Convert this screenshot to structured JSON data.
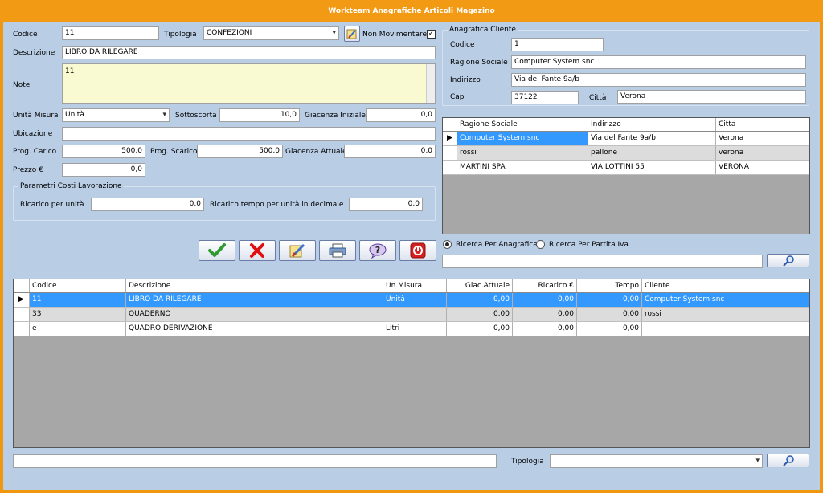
{
  "window": {
    "title": "Workteam Anagrafiche Articoli Magazino"
  },
  "article": {
    "codice_label": "Codice",
    "codice": "11",
    "tipologia_label": "Tipologia",
    "tipologia": "CONFEZIONI",
    "non_movimentare_label": "Non Movimentare",
    "non_movimentare_check": "✓",
    "descrizione_label": "Descrizione",
    "descrizione": "LIBRO DA RILEGARE",
    "note_label": "Note",
    "note": "11",
    "unita_misura_label": "Unità Misura",
    "unita_misura": "Unità",
    "sottoscorta_label": "Sottoscorta",
    "sottoscorta": "10,0",
    "giacenza_iniziale_label": "Giacenza Iniziale",
    "giacenza_iniziale": "0,0",
    "ubicazione_label": "Ubicazione",
    "ubicazione": "",
    "prog_carico_label": "Prog. Carico",
    "prog_carico": "500,0",
    "prog_scarico_label": "Prog. Scarico",
    "prog_scarico": "500,0",
    "giacenza_attuale_label": "Giacenza Attuale",
    "giacenza_attuale": "0,0",
    "prezzo_label": "Prezzo €",
    "prezzo": "0,0"
  },
  "costi": {
    "title": "Parametri Costi Lavorazione",
    "ricarico_label": "Ricarico per unità",
    "ricarico": "0,0",
    "tempo_label": "Ricarico tempo per unità in decimale",
    "tempo": "0,0"
  },
  "cliente": {
    "title": "Anagrafica Cliente",
    "codice_label": "Codice",
    "codice": "1",
    "ragione_label": "Ragione Sociale",
    "ragione": "Computer System snc",
    "indirizzo_label": "Indirizzo",
    "indirizzo": "Via del Fante 9a/b",
    "cap_label": "Cap",
    "cap": "37122",
    "citta_label": "Città",
    "citta": "Verona"
  },
  "clienti_grid": {
    "headers": [
      "Ragione Sociale",
      "Indirizzo",
      "Citta"
    ],
    "rows": [
      [
        "Computer System snc",
        "Via del Fante 9a/b",
        "Verona"
      ],
      [
        "rossi",
        "pallone",
        "verona"
      ],
      [
        "MARTINI SPA",
        "VIA LOTTINI 55",
        "VERONA"
      ]
    ]
  },
  "search_mode": {
    "anagrafica_label": "Ricerca Per Anagrafica",
    "partita_iva_label": "Ricerca Per Partita Iva",
    "query": ""
  },
  "articoli_grid": {
    "headers": [
      "Codice",
      "Descrizione",
      "Un.Misura",
      "Giac.Attuale",
      "Ricarico €",
      "Tempo",
      "Cliente"
    ],
    "rows": [
      [
        "11",
        "LIBRO DA RILEGARE",
        "Unità",
        "0,00",
        "0,00",
        "0,00",
        "Computer System snc"
      ],
      [
        "33",
        "QUADERNO",
        "",
        "0,00",
        "0,00",
        "0,00",
        "rossi"
      ],
      [
        "e",
        "QUADRO DERIVAZIONE",
        "Litri",
        "0,00",
        "0,00",
        "0,00",
        ""
      ]
    ]
  },
  "bottom": {
    "filter": "",
    "tipologia_label": "Tipologia",
    "tipologia": ""
  },
  "icons": [
    "confirm-check-icon",
    "cancel-x-icon",
    "clean-brush-icon",
    "print-icon",
    "help-icon",
    "exit-power-icon",
    "search-magnifier-icon"
  ],
  "colors": {
    "titlebar": "#f29a14",
    "background": "#b9cde5",
    "selection": "#3399ff",
    "note_bg": "#fafad2"
  }
}
